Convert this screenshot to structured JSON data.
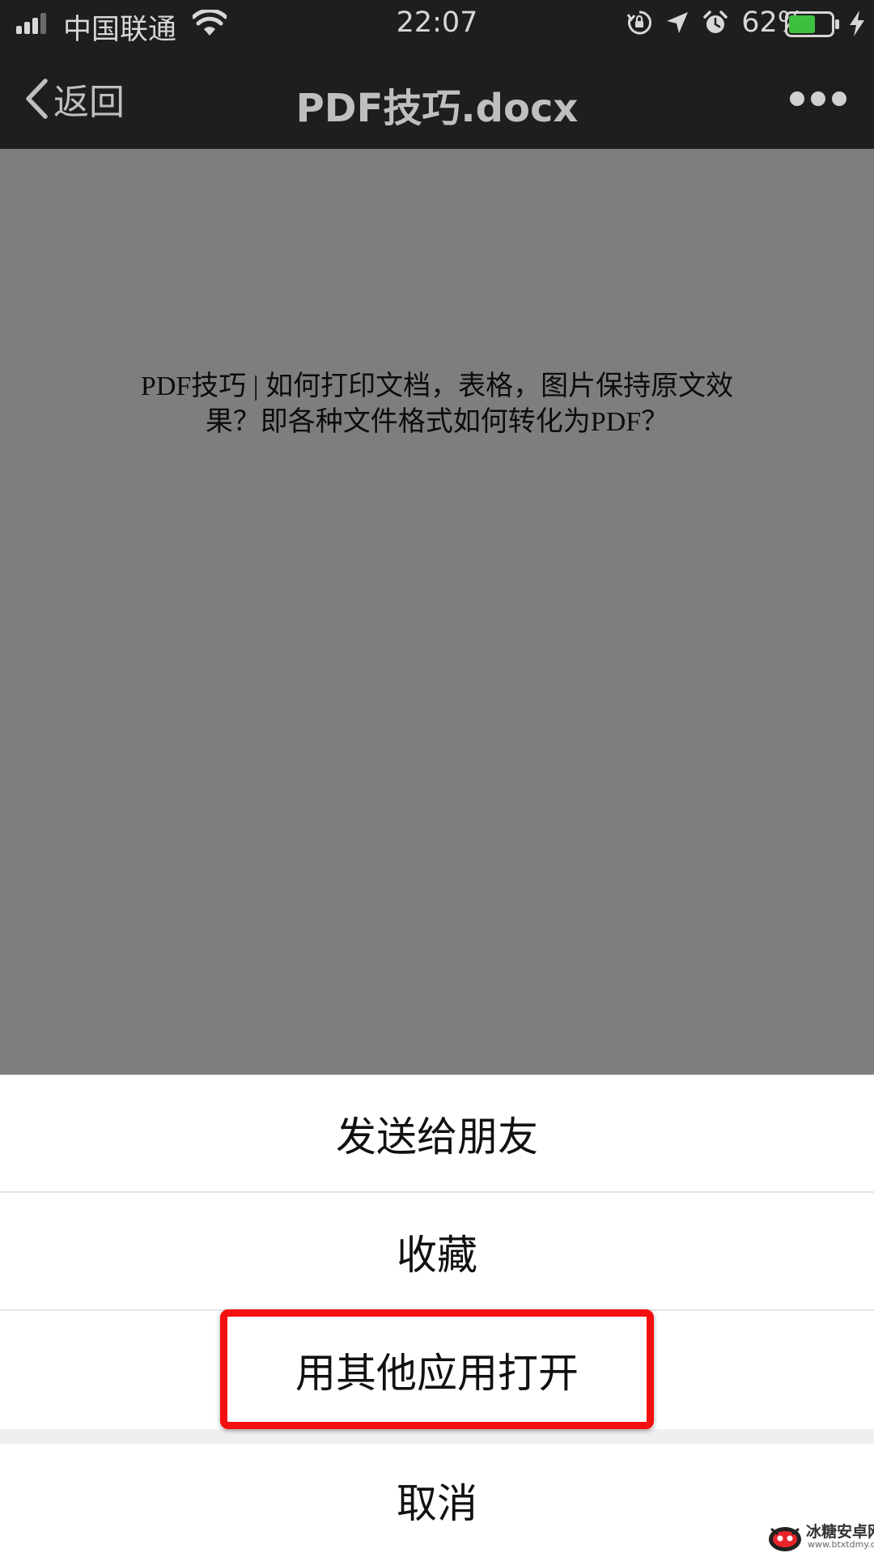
{
  "status_bar": {
    "carrier": "中国联通",
    "time": "22:07",
    "battery_percent": "62%",
    "battery_level": 0.62,
    "icons": [
      "signal-icon",
      "wifi-icon",
      "orientation-lock-icon",
      "location-arrow-icon",
      "alarm-icon",
      "battery-icon",
      "charging-bolt-icon"
    ]
  },
  "nav": {
    "back_label": "返回",
    "title": "PDF技巧.docx",
    "more_icon": "more-dots-icon"
  },
  "document": {
    "line1": "PDF技巧 | 如何打印文档，表格，图片保持原文效",
    "line2": "果？即各种文件格式如何转化为PDF？"
  },
  "action_sheet": {
    "items": [
      {
        "label": "发送给朋友"
      },
      {
        "label": "收藏"
      },
      {
        "label": "用其他应用打开",
        "highlighted": true
      }
    ],
    "cancel_label": "取消"
  },
  "colors": {
    "header_bg": "#1e1e1f",
    "doc_bg": "#807d81",
    "highlight": "#f40f10",
    "battery_fill": "#3fbf3f"
  },
  "watermark": {
    "name": "冰糖安卓网",
    "url": "www.btxtdmy.com"
  }
}
